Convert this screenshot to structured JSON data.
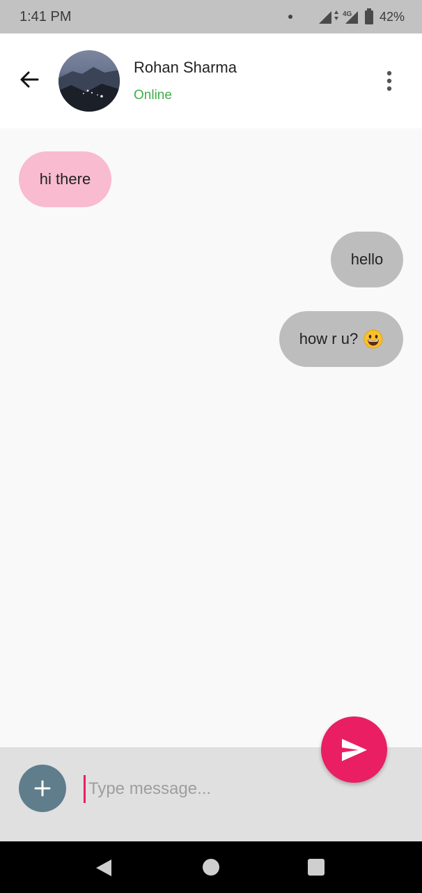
{
  "status_bar": {
    "time": "1:41 PM",
    "network": "4G",
    "battery": "42%",
    "icons": [
      "notification-dot-icon",
      "signal-icon",
      "data-arrows-icon",
      "signal-icon",
      "battery-icon"
    ]
  },
  "header": {
    "back_icon": "arrow-left-icon",
    "contact_name": "Rohan Sharma",
    "status": "Online",
    "menu_icon": "more-vert-icon"
  },
  "messages": [
    {
      "direction": "incoming",
      "text": "hi there"
    },
    {
      "direction": "outgoing",
      "text": "hello"
    },
    {
      "direction": "outgoing",
      "text": "how r u?",
      "emoji": "grinning-face-emoji"
    }
  ],
  "composer": {
    "add_icon": "plus-icon",
    "placeholder": "Type message...",
    "value": "",
    "send_icon": "send-icon"
  },
  "nav_bar": {
    "icons": [
      "nav-back-icon",
      "nav-home-icon",
      "nav-recents-icon"
    ]
  },
  "colors": {
    "status_bar_bg": "#c2c2c2",
    "header_bg": "#ffffff",
    "chat_bg": "#f9f9f9",
    "incoming_bubble": "#f8bbd0",
    "outgoing_bubble": "#bdbdbd",
    "online_green": "#3fae48",
    "send_accent": "#e91e63",
    "add_button": "#607d8b",
    "input_bar_bg": "#e0e0e0"
  }
}
